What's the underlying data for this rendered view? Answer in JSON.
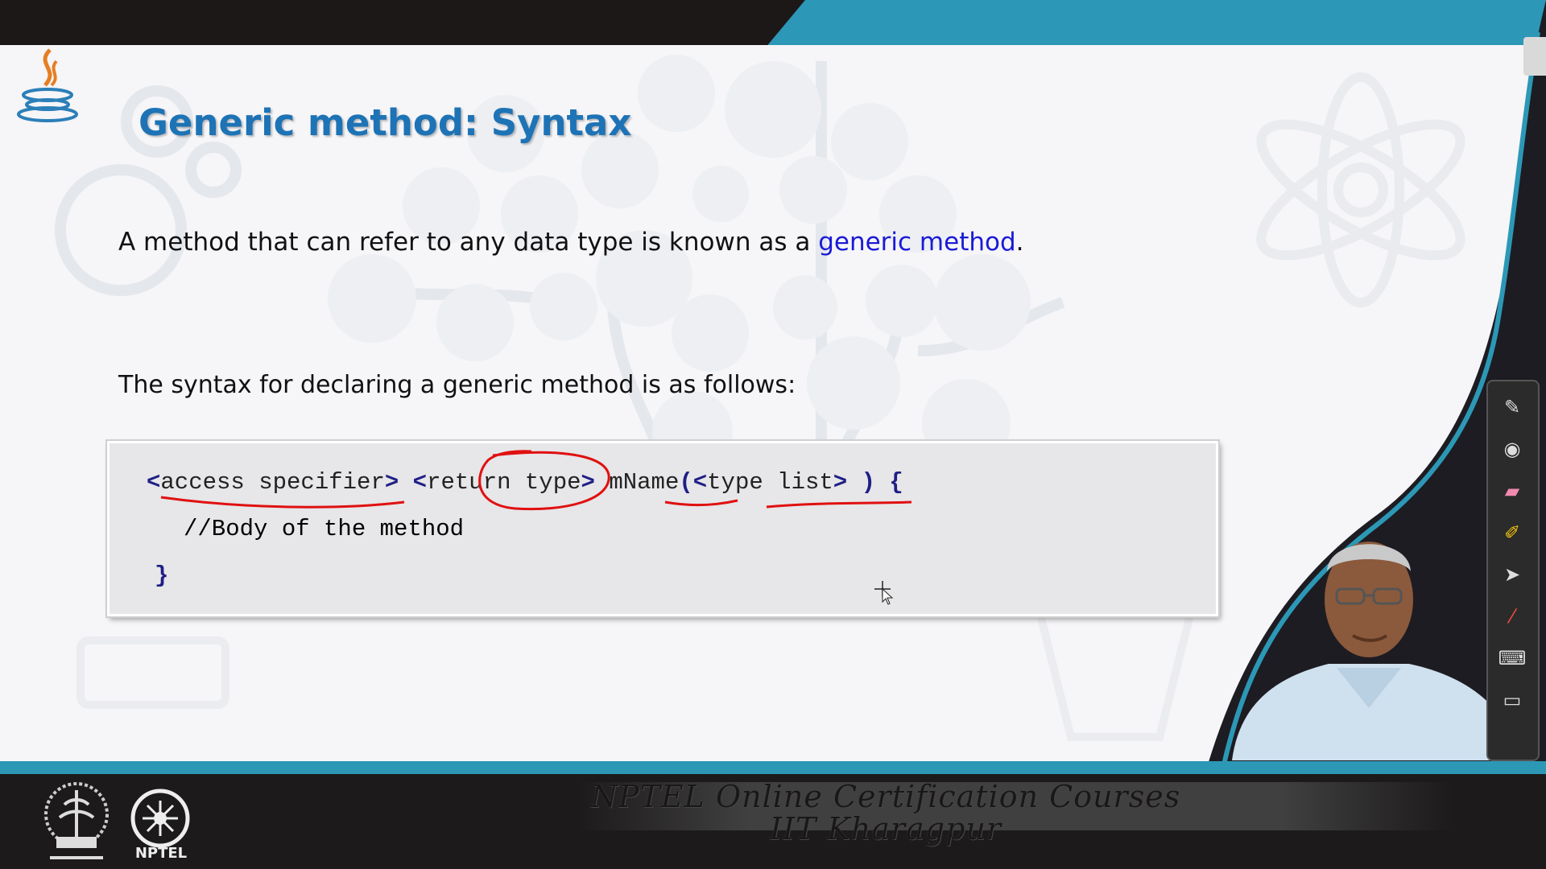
{
  "slide": {
    "title": "Generic method: Syntax",
    "definition_prefix": "A method that can refer to any data type is known as a ",
    "definition_term": "generic method",
    "definition_suffix": ".",
    "syntax_intro": "The syntax for declaring a generic method is as follows:"
  },
  "code": {
    "line1": {
      "open1": "<",
      "access": "access specifier",
      "close1": ">",
      "open2": "<",
      "ret": "return type",
      "close2": ">",
      "name": "mName",
      "paren": "(<",
      "tlist": "type list",
      "closer": "> ) {"
    },
    "comment": "//Body of the method",
    "close_brace": "}"
  },
  "footer": {
    "line1": "NPTEL Online Certification Courses",
    "line2": "IIT Kharagpur",
    "logo_label": "NPTEL"
  },
  "colors": {
    "title": "#1d73b5",
    "keyword": "#1f1f86",
    "comment": "#2a9a2a",
    "highlight_term": "#1a1ad6",
    "annotation": "#e01010",
    "teal": "#2d97b8"
  }
}
